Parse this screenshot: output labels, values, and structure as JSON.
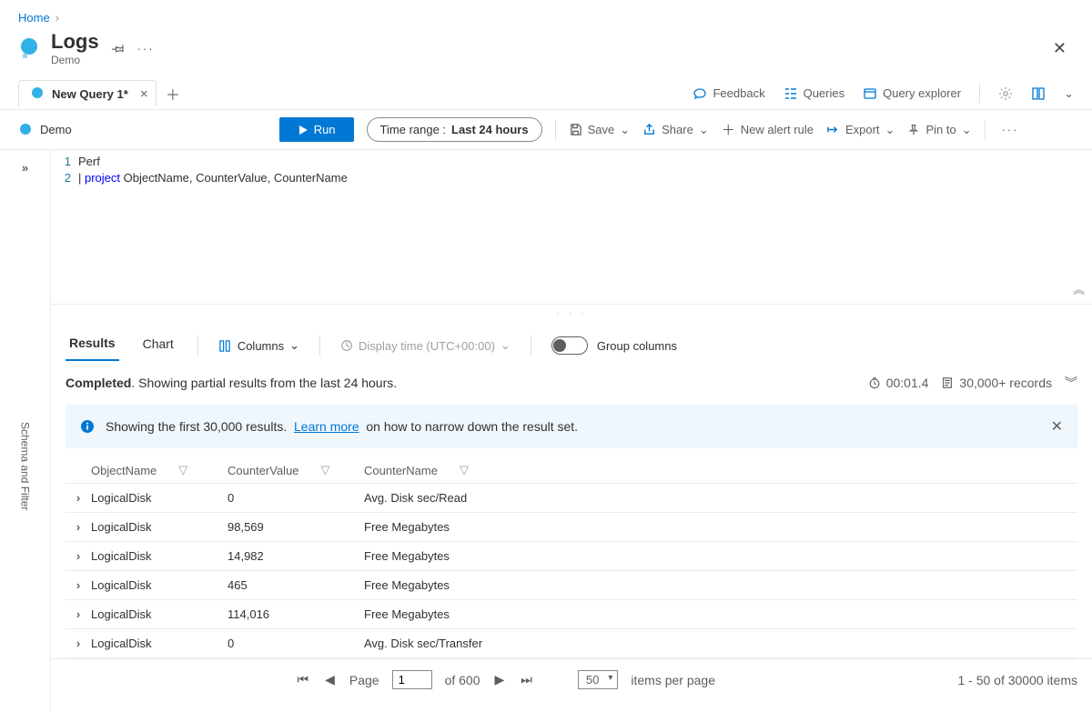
{
  "breadcrumb": {
    "home": "Home"
  },
  "header": {
    "title": "Logs",
    "subtitle": "Demo"
  },
  "tabs": {
    "active_label": "New Query 1*"
  },
  "top_commands": {
    "feedback": "Feedback",
    "queries": "Queries",
    "query_explorer": "Query explorer"
  },
  "toolbar": {
    "workspace": "Demo",
    "run": "Run",
    "time_prefix": "Time range :",
    "time_value": "Last 24 hours",
    "save": "Save",
    "share": "Share",
    "new_alert": "New alert rule",
    "export": "Export",
    "pin": "Pin to"
  },
  "editor": {
    "line1": "Perf",
    "line2_prefix": "| ",
    "line2_keyword": "project",
    "line2_rest": " ObjectName, CounterValue, CounterName"
  },
  "side_rail_label": "Schema and Filter",
  "results_bar": {
    "results": "Results",
    "chart": "Chart",
    "columns": "Columns",
    "display_time": "Display time (UTC+00:00)",
    "group_columns": "Group columns"
  },
  "status": {
    "completed": "Completed",
    "message": ". Showing partial results from the last 24 hours.",
    "elapsed": "00:01.4",
    "records": "30,000+ records"
  },
  "info_banner": {
    "text1": "Showing the first 30,000 results.",
    "learn_more": "Learn more",
    "text2": "on how to narrow down the result set."
  },
  "grid": {
    "headers": {
      "c1": "ObjectName",
      "c2": "CounterValue",
      "c3": "CounterName"
    },
    "rows": [
      {
        "object": "LogicalDisk",
        "value": "0",
        "counter": "Avg. Disk sec/Read"
      },
      {
        "object": "LogicalDisk",
        "value": "98,569",
        "counter": "Free Megabytes"
      },
      {
        "object": "LogicalDisk",
        "value": "14,982",
        "counter": "Free Megabytes"
      },
      {
        "object": "LogicalDisk",
        "value": "465",
        "counter": "Free Megabytes"
      },
      {
        "object": "LogicalDisk",
        "value": "114,016",
        "counter": "Free Megabytes"
      },
      {
        "object": "LogicalDisk",
        "value": "0",
        "counter": "Avg. Disk sec/Transfer"
      }
    ]
  },
  "pager": {
    "page_label": "Page",
    "current_page": "1",
    "of_pages": "of 600",
    "per_page": "50",
    "per_page_label": "items per page",
    "summary": "1 - 50 of 30000 items"
  }
}
